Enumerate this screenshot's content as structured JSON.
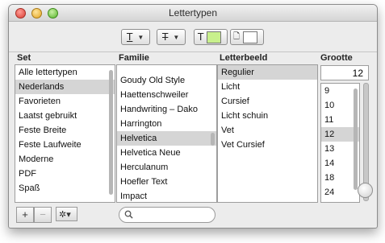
{
  "window": {
    "title": "Lettertypen"
  },
  "toolbar": {
    "underline_glyph": "T",
    "strike_glyph": "T",
    "text_color_glyph": "T",
    "text_color_swatch": "#c8f08c",
    "doc_glyph": "🗋",
    "doc_color_swatch": "#ffffff"
  },
  "columns": {
    "set": "Set",
    "familie": "Familie",
    "letterbeeld": "Letterbeeld",
    "grootte": "Grootte"
  },
  "sets": [
    {
      "label": "Alle lettertypen",
      "selected": false
    },
    {
      "label": "Nederlands",
      "selected": true
    },
    {
      "label": "Favorieten",
      "selected": false
    },
    {
      "label": "Laatst gebruikt",
      "selected": false
    },
    {
      "label": "Feste Breite",
      "selected": false
    },
    {
      "label": "Feste Laufweite",
      "selected": false
    },
    {
      "label": "Moderne",
      "selected": false
    },
    {
      "label": "PDF",
      "selected": false
    },
    {
      "label": "Spaß",
      "selected": false
    }
  ],
  "families": [
    {
      "label": "Goudy Old Style",
      "selected": false
    },
    {
      "label": "Haettenschweiler",
      "selected": false
    },
    {
      "label": "Handwriting – Dako",
      "selected": false
    },
    {
      "label": "Harrington",
      "selected": false
    },
    {
      "label": "Helvetica",
      "selected": true
    },
    {
      "label": "Helvetica Neue",
      "selected": false
    },
    {
      "label": "Herculanum",
      "selected": false
    },
    {
      "label": "Hoefler Text",
      "selected": false
    },
    {
      "label": "Impact",
      "selected": false
    }
  ],
  "styles": [
    {
      "label": "Regulier",
      "selected": true
    },
    {
      "label": "Licht",
      "selected": false
    },
    {
      "label": "Cursief",
      "selected": false
    },
    {
      "label": "Licht schuin",
      "selected": false
    },
    {
      "label": "Vet",
      "selected": false
    },
    {
      "label": "Vet Cursief",
      "selected": false
    }
  ],
  "size": {
    "value": "12",
    "options": [
      {
        "label": "9",
        "selected": false
      },
      {
        "label": "10",
        "selected": false
      },
      {
        "label": "11",
        "selected": false
      },
      {
        "label": "12",
        "selected": true
      },
      {
        "label": "13",
        "selected": false
      },
      {
        "label": "14",
        "selected": false
      },
      {
        "label": "18",
        "selected": false
      },
      {
        "label": "24",
        "selected": false
      }
    ]
  },
  "bottom": {
    "add_label": "+",
    "remove_label": "−",
    "gear_label": "✲▾",
    "search_placeholder": ""
  }
}
